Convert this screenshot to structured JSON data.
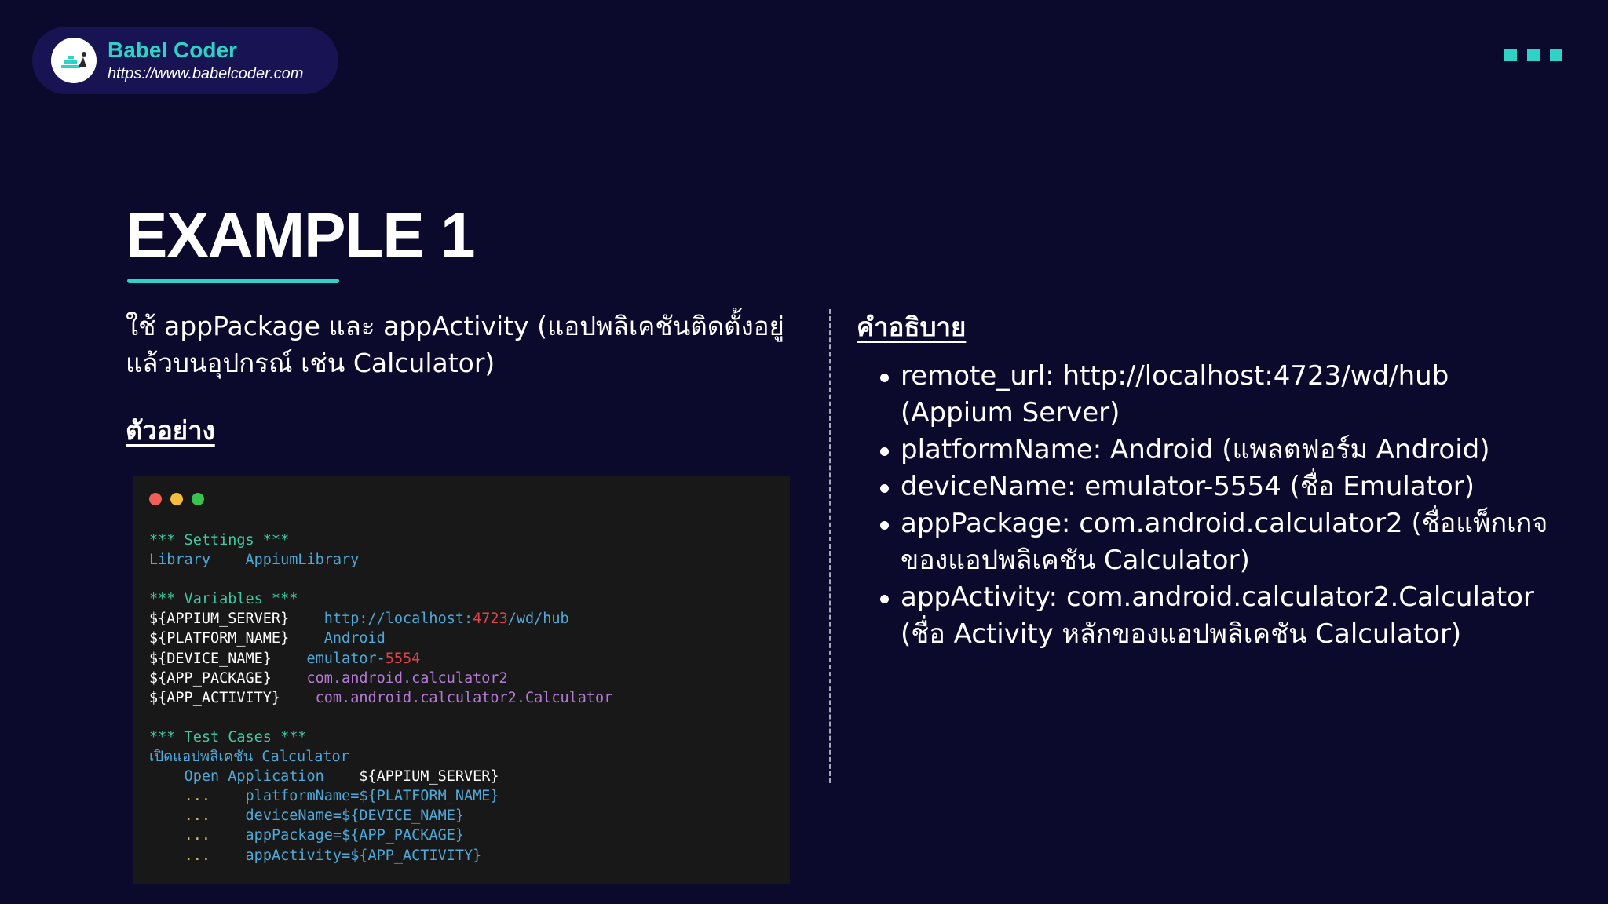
{
  "brand": {
    "name": "Babel Coder",
    "url": "https://www.babelcoder.com"
  },
  "slide": {
    "title": "EXAMPLE 1",
    "description": "ใช้ appPackage และ appActivity (แอปพลิเคชันติดตั้งอยู่แล้วบนอุปกรณ์ เช่น Calculator)",
    "example_label": "ตัวอย่าง",
    "explanation_label": "คำอธิบาย",
    "explanations": [
      "remote_url: http://localhost:4723/wd/hub (Appium Server)",
      "platformName: Android (แพลตฟอร์ม Android)",
      "deviceName: emulator-5554 (ชื่อ Emulator)",
      "appPackage: com.android.calculator2 (ชื่อแพ็กเกจของแอปพลิเคชัน Calculator)",
      "appActivity: com.android.calculator2.Calculator (ชื่อ Activity หลักของแอปพลิเคชัน Calculator)"
    ]
  },
  "code": {
    "settings_header": "*** Settings ***",
    "library_kw": "Library",
    "library_val": "AppiumLibrary",
    "variables_header": "*** Variables ***",
    "appium_var": "${APPIUM_SERVER}",
    "appium_val_1": "http://localhost:",
    "appium_port": "4723",
    "appium_val_2": "/wd/hub",
    "platform_var": "${PLATFORM_NAME}",
    "platform_val": "Android",
    "device_var": "${DEVICE_NAME}",
    "device_val_1": "emulator-",
    "device_num": "5554",
    "package_var": "${APP_PACKAGE}",
    "package_val": "com.android.calculator2",
    "activity_var": "${APP_ACTIVITY}",
    "activity_val": "com.android.calculator2.Calculator",
    "testcases_header": "*** Test Cases ***",
    "test_name": "เปิดแอปพลิเคชัน Calculator",
    "open_app_kw": "Open Application",
    "open_app_arg": "${APPIUM_SERVER}",
    "continuation": "...",
    "arg_platform": "platformName=${PLATFORM_NAME}",
    "arg_device": "deviceName=${DEVICE_NAME}",
    "arg_package": "appPackage=${APP_PACKAGE}",
    "arg_activity": "appActivity=${APP_ACTIVITY}"
  },
  "colors": {
    "background": "#0c0a2c",
    "accent": "#2ed3c6",
    "code_bg": "#181818",
    "traffic_red": "#ed5f58",
    "traffic_yellow": "#f4bd3c",
    "traffic_green": "#39c24e"
  },
  "icons": {
    "logo": "babel-coder-logo",
    "menu": "three-squares"
  }
}
